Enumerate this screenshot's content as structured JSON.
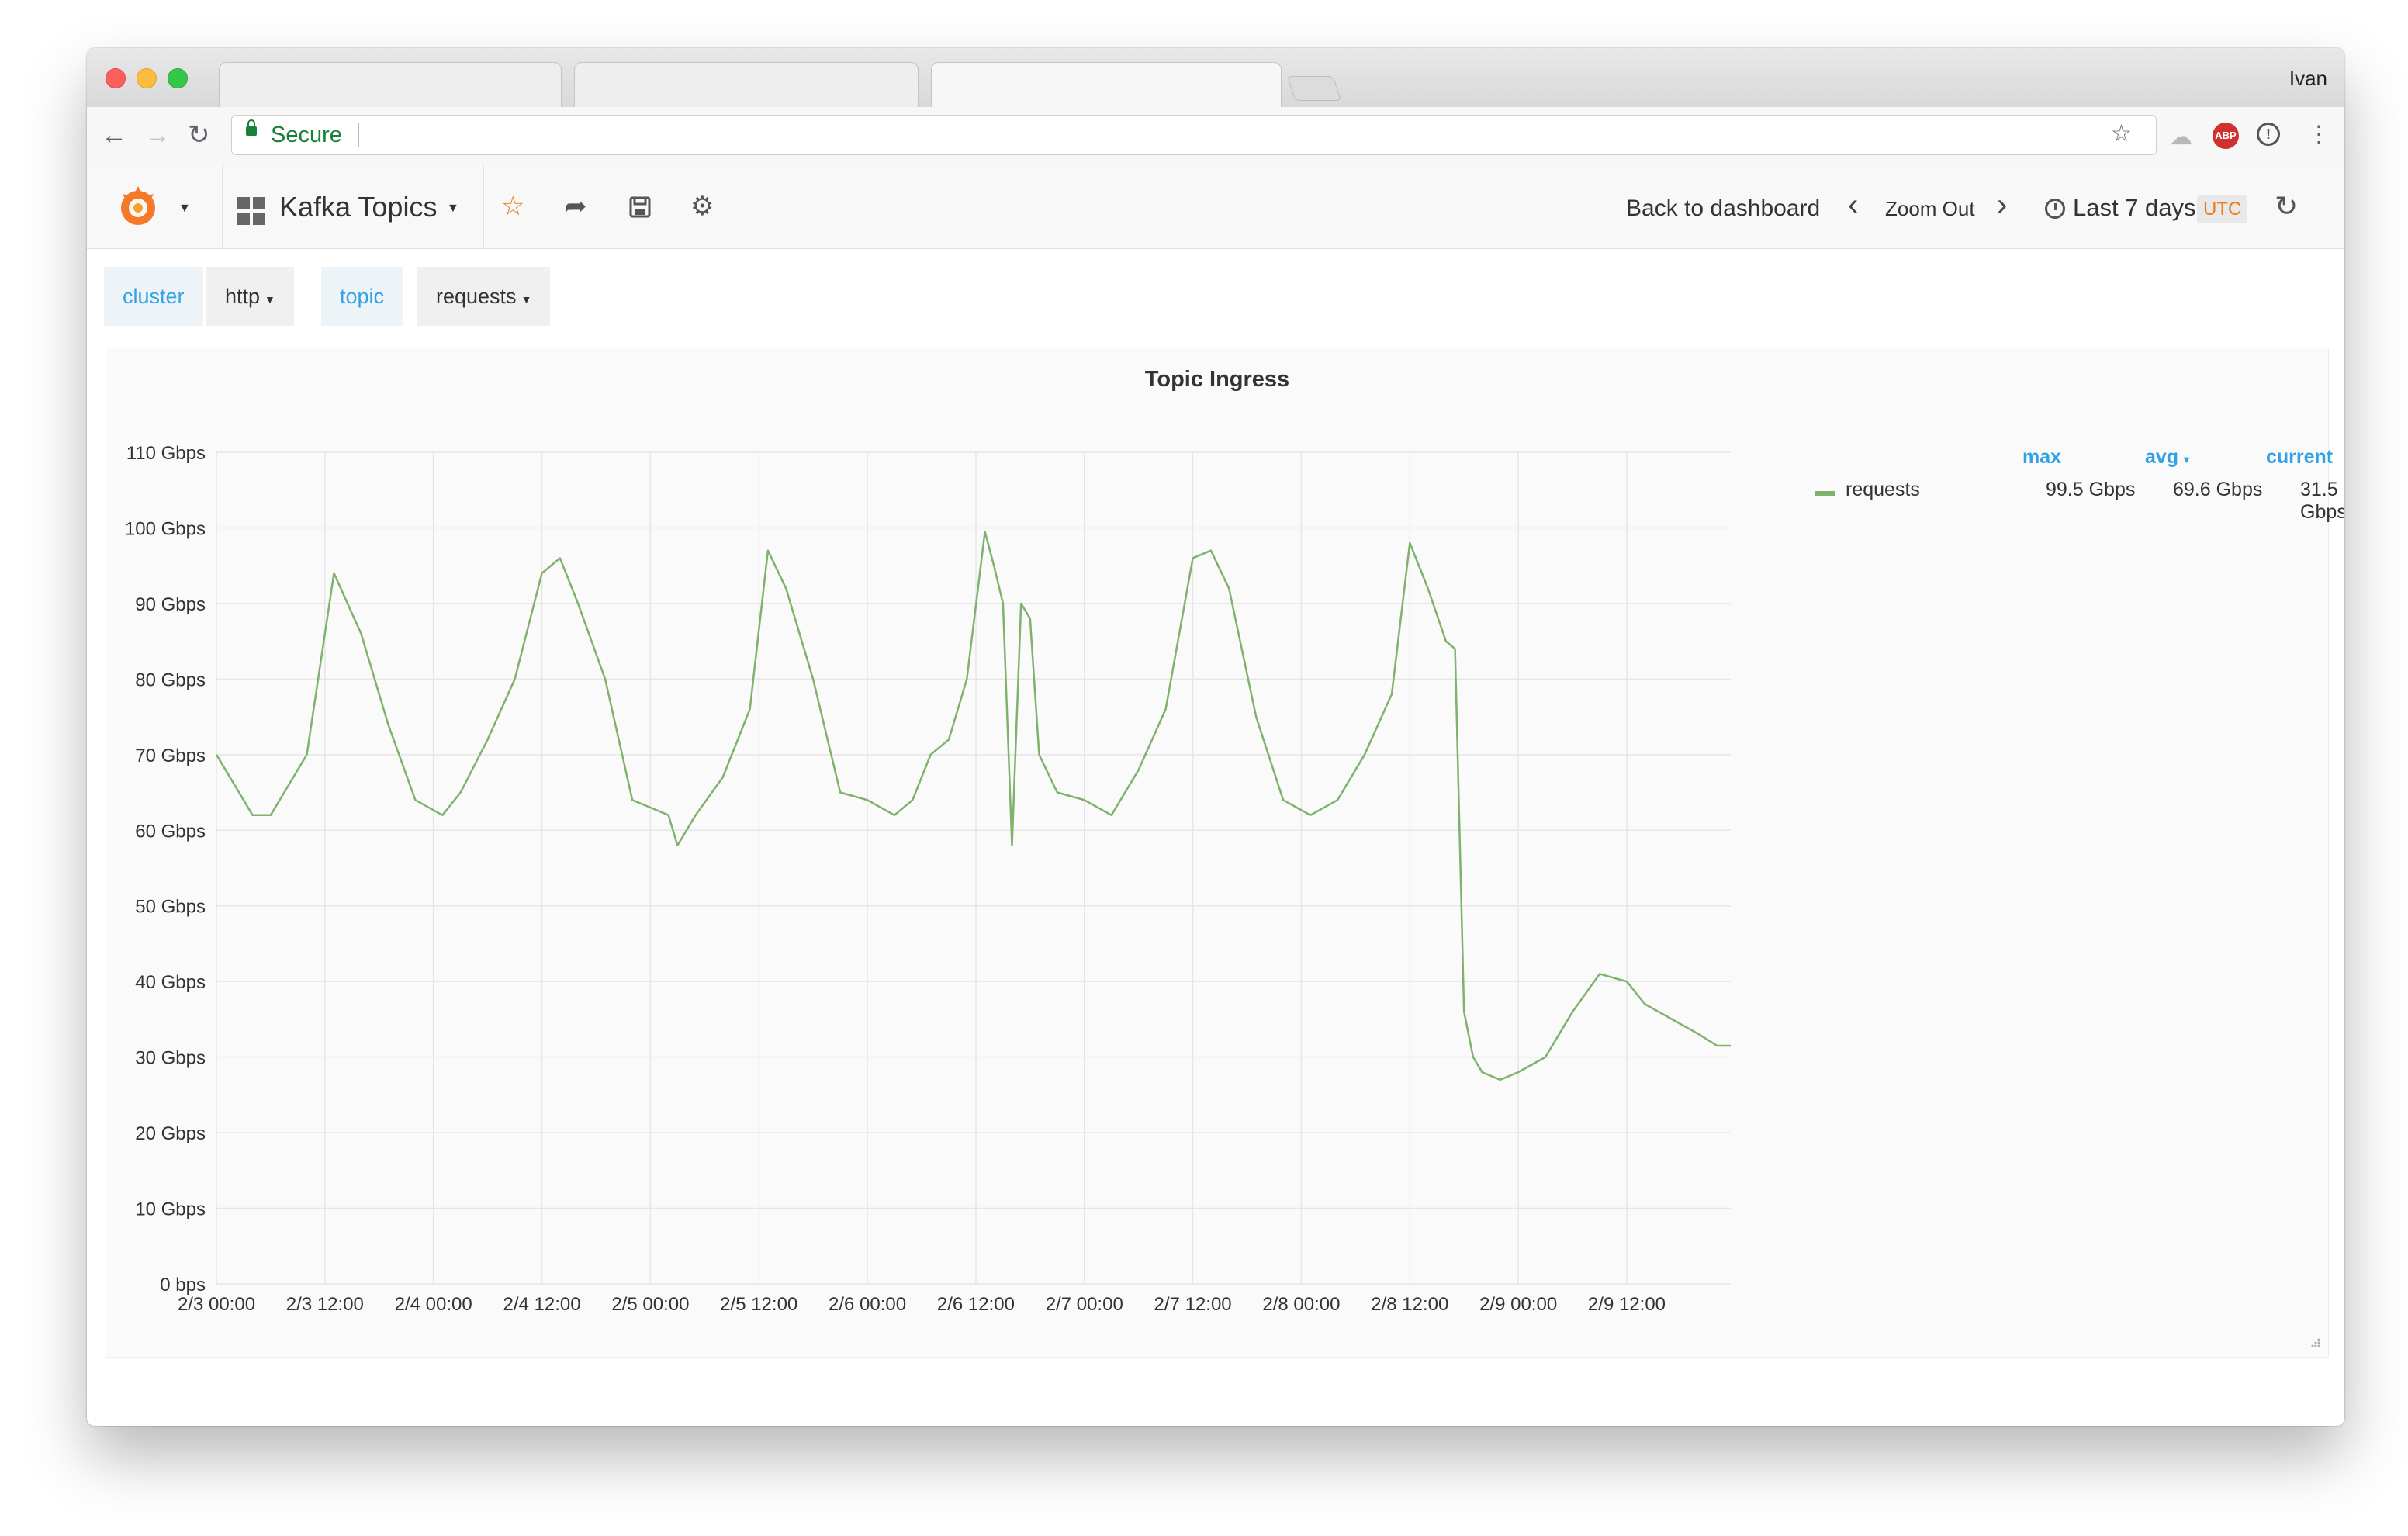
{
  "browser": {
    "user": "Ivan",
    "secure_label": "Secure",
    "url": ""
  },
  "dashboard": {
    "title": "Kafka Topics",
    "back_link": "Back to dashboard",
    "zoom_out": "Zoom Out",
    "time_range": "Last 7 days",
    "timezone": "UTC"
  },
  "variables": [
    {
      "label": "cluster",
      "value": "http"
    },
    {
      "label": "topic",
      "value": "requests"
    }
  ],
  "icons": {
    "star": "star-icon",
    "share": "share-icon",
    "save": "save-icon",
    "settings": "gear-icon",
    "refresh": "refresh-icon"
  },
  "colors": {
    "series": "#7eb26d",
    "link": "#33a2e5",
    "star": "#eb7b18"
  },
  "panel": {
    "title": "Topic Ingress",
    "legend": {
      "columns": [
        "max",
        "avg",
        "current"
      ],
      "series_name": "requests",
      "max": "99.5 Gbps",
      "avg": "69.6 Gbps",
      "current": "31.5 Gbps"
    }
  },
  "chart_data": {
    "type": "line",
    "title": "Topic Ingress",
    "xlabel": "",
    "ylabel": "",
    "grid": true,
    "legend_position": "right",
    "ylim": [
      0,
      110
    ],
    "xlim": [
      "2/3 00:00",
      "2/9 23:30"
    ],
    "y_ticks": [
      "0 bps",
      "10 Gbps",
      "20 Gbps",
      "30 Gbps",
      "40 Gbps",
      "50 Gbps",
      "60 Gbps",
      "70 Gbps",
      "80 Gbps",
      "90 Gbps",
      "100 Gbps",
      "110 Gbps"
    ],
    "x_ticks": [
      "2/3 00:00",
      "2/3 12:00",
      "2/4 00:00",
      "2/4 12:00",
      "2/5 00:00",
      "2/5 12:00",
      "2/6 00:00",
      "2/6 12:00",
      "2/7 00:00",
      "2/7 12:00",
      "2/8 00:00",
      "2/8 12:00",
      "2/9 00:00",
      "2/9 12:00"
    ],
    "series": [
      {
        "name": "requests",
        "color": "#7eb26d",
        "x": [
          "2/3 00:00",
          "2/3 02:00",
          "2/3 04:00",
          "2/3 06:00",
          "2/3 08:00",
          "2/3 10:00",
          "2/3 13:00",
          "2/3 16:00",
          "2/3 19:00",
          "2/3 22:00",
          "2/4 01:00",
          "2/4 03:00",
          "2/4 06:00",
          "2/4 09:00",
          "2/4 12:00",
          "2/4 14:00",
          "2/4 15:00",
          "2/4 16:00",
          "2/4 19:00",
          "2/4 22:00",
          "2/5 00:00",
          "2/5 02:00",
          "2/5 03:00",
          "2/5 05:00",
          "2/5 08:00",
          "2/5 11:00",
          "2/5 13:00",
          "2/5 15:00",
          "2/5 18:00",
          "2/5 21:00",
          "2/6 00:00",
          "2/6 03:00",
          "2/6 05:00",
          "2/6 07:00",
          "2/6 09:00",
          "2/6 11:00",
          "2/6 13:00",
          "2/6 14:00",
          "2/6 15:00",
          "2/6 16:00",
          "2/6 17:00",
          "2/6 18:00",
          "2/6 19:00",
          "2/6 21:00",
          "2/7 00:00",
          "2/7 03:00",
          "2/7 06:00",
          "2/7 09:00",
          "2/7 12:00",
          "2/7 14:00",
          "2/7 16:00",
          "2/7 19:00",
          "2/7 22:00",
          "2/8 01:00",
          "2/8 04:00",
          "2/8 07:00",
          "2/8 10:00",
          "2/8 12:00",
          "2/8 14:00",
          "2/8 16:00",
          "2/8 17:00",
          "2/8 18:00",
          "2/8 19:00",
          "2/8 20:00",
          "2/8 22:00",
          "2/9 00:00",
          "2/9 03:00",
          "2/9 06:00",
          "2/9 09:00",
          "2/9 12:00",
          "2/9 14:00",
          "2/9 17:00",
          "2/9 20:00",
          "2/9 22:00",
          "2/9 23:30"
        ],
        "y": [
          70,
          66,
          62,
          62,
          66,
          70,
          94,
          86,
          74,
          64,
          62,
          65,
          72,
          80,
          94,
          96,
          93,
          90,
          80,
          64,
          63,
          62,
          58,
          62,
          67,
          76,
          97,
          92,
          80,
          65,
          64,
          62,
          64,
          70,
          72,
          80,
          99.5,
          95,
          90,
          58,
          90,
          88,
          70,
          65,
          64,
          62,
          68,
          76,
          96,
          97,
          92,
          75,
          64,
          62,
          64,
          70,
          78,
          98,
          92,
          85,
          84,
          36,
          30,
          28,
          27,
          28,
          30,
          36,
          41,
          40,
          37,
          35,
          33,
          31.5,
          31.5
        ]
      }
    ]
  }
}
